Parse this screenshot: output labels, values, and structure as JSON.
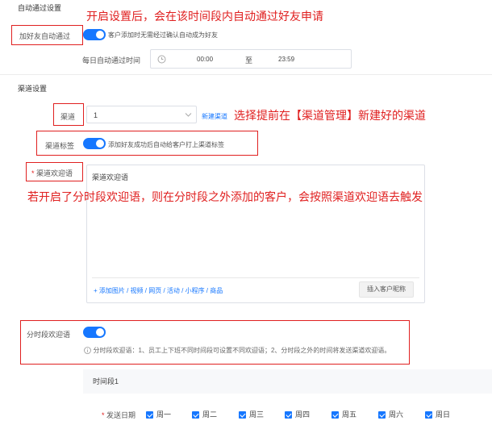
{
  "auto_approve": {
    "section_title": "自动通过设置",
    "annotation": "开启设置后，会在该时间段内自动通过好友申请",
    "label": "加好友自动通过",
    "hint": "客户添加时无需经过确认自动成为好友",
    "time_label": "每日自动通过时间",
    "time_start": "00:00",
    "time_sep": "至",
    "time_end": "23:59"
  },
  "channel": {
    "section_title": "渠道设置",
    "label": "渠道",
    "select_value": "1",
    "new_link": "新建渠道",
    "annotation": "选择提前在【渠道管理】新建好的渠道",
    "tag_label": "渠道标签",
    "tag_hint": "添加好友成功后自动给客户打上渠道标签",
    "welcome_label": "渠道欢迎语",
    "welcome_required": "*",
    "welcome_text": "渠道欢迎语",
    "welcome_annotation": "若开启了分时段欢迎语，则在分时段之外添加的客户，会按照渠道欢迎语去触发",
    "attach_link": "+ 添加图片 / 视频 / 网页 / 活动 / 小程序 / 商品",
    "insert_button": "插入客户昵称"
  },
  "timed_welcome": {
    "label": "分时段欢迎语",
    "hint": "分时段欢迎语：1、员工上下班不同时间段可设置不同欢迎语；2、分时段之外的时间将发送渠道欢迎语。",
    "period_title": "时间段1",
    "date_label": "发送日期",
    "date_required": "*",
    "days": [
      "周一",
      "周二",
      "周三",
      "周四",
      "周五",
      "周六",
      "周日"
    ]
  },
  "colors": {
    "accent": "#1677ff",
    "annotation_red": "#e02020"
  }
}
